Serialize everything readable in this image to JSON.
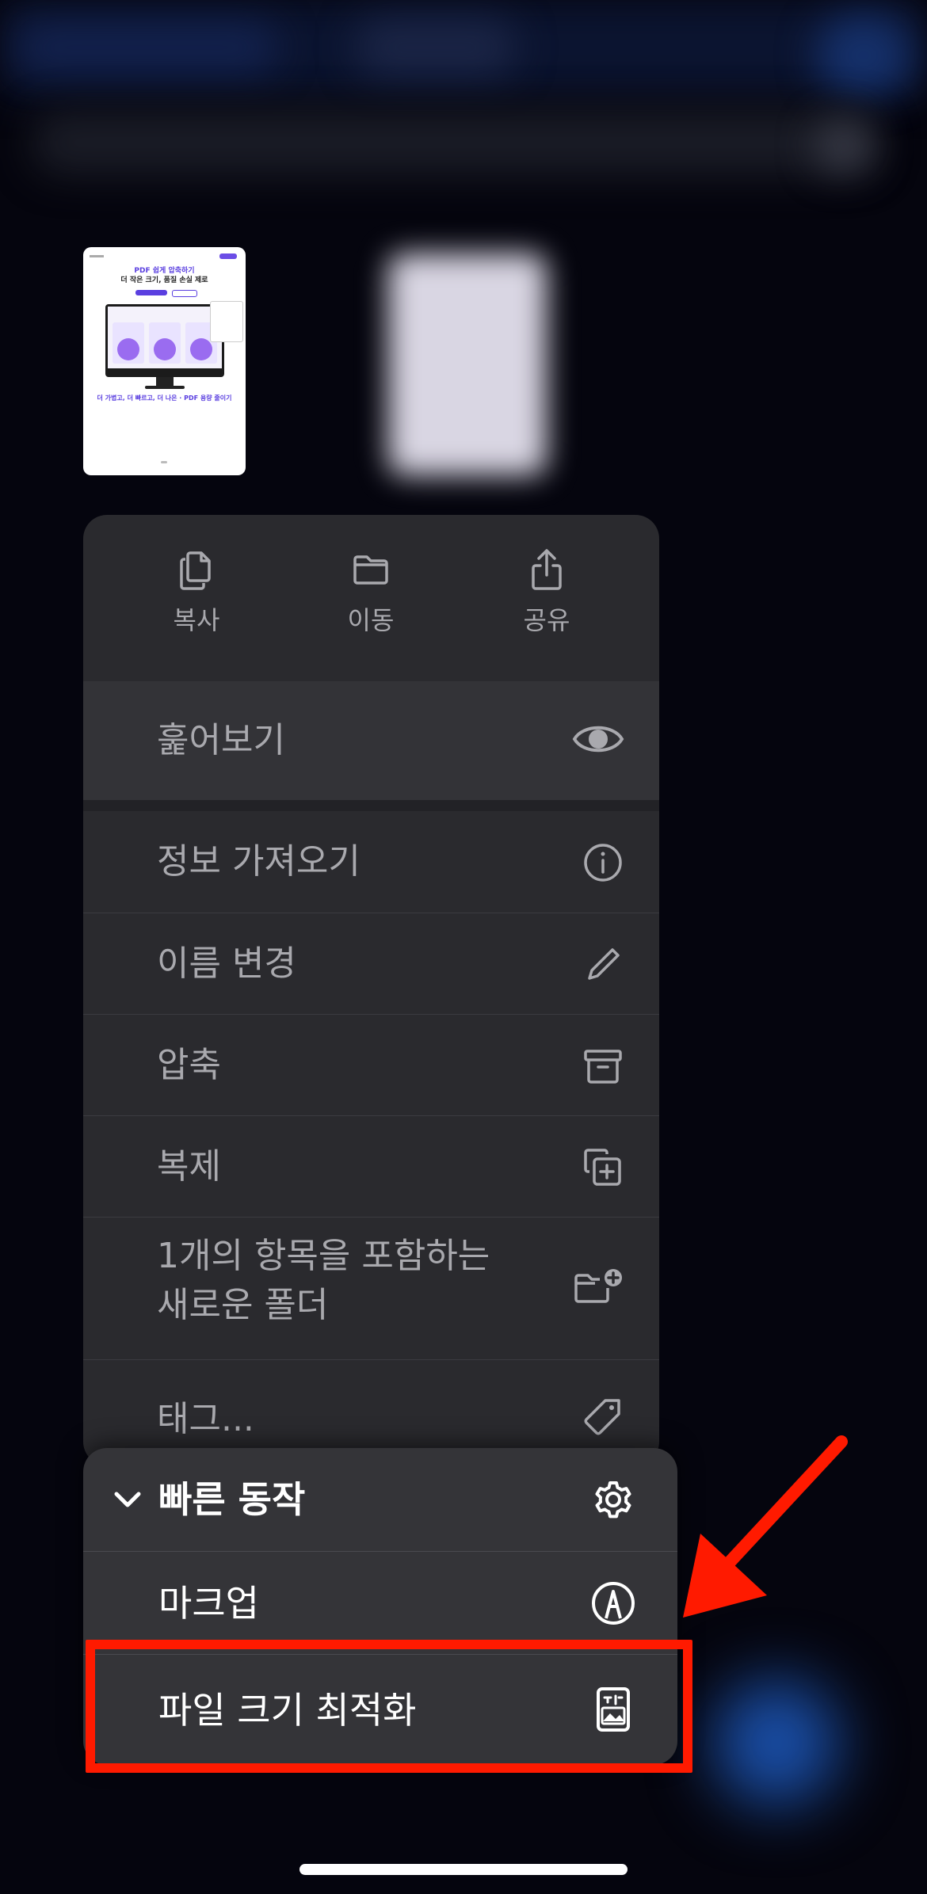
{
  "thumbnail": {
    "title_line1": "PDF 쉽게 압축하기",
    "title_line2": "더 작은 크기, 품질 손실 제로",
    "caption": "더 가볍고, 더 빠르고, 더 나은 · PDF 용량 줄이기"
  },
  "quick_actions": [
    {
      "label": "복사",
      "icon": "copy-icon"
    },
    {
      "label": "이동",
      "icon": "folder-icon"
    },
    {
      "label": "공유",
      "icon": "share-icon"
    }
  ],
  "menu": {
    "quick_look": "훑어보기",
    "get_info": "정보 가져오기",
    "rename": "이름 변경",
    "compress": "압축",
    "duplicate": "복제",
    "new_folder_line1": "1개의 항목을 포함하는",
    "new_folder_line2": "새로운 폴더",
    "tags": "태그..."
  },
  "submenu": {
    "header": "빠른 동작",
    "markup": "마크업",
    "optimize": "파일 크기 최적화"
  },
  "colors": {
    "menu_bg": "#2a2a2e",
    "submenu_bg": "#343438",
    "highlight": "#ff1a00"
  }
}
